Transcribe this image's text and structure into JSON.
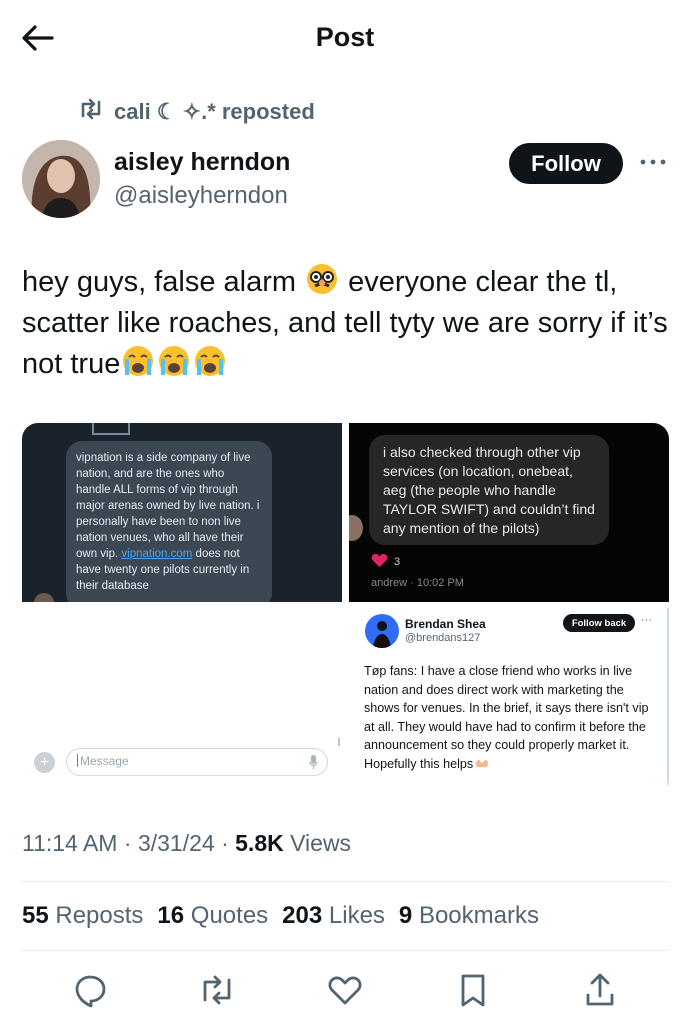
{
  "header": {
    "title": "Post"
  },
  "repost": {
    "text": "cali ☾ ✧.* reposted"
  },
  "author": {
    "name": "aisley herndon",
    "handle": "@aisleyherndon",
    "follow_label": "Follow"
  },
  "post": {
    "text": "hey guys, false alarm ",
    "text2": " everyone clear the tl, scatter like roaches, and tell tyty we are sorry if it’s not true"
  },
  "media": {
    "panel1": {
      "message_pre": "vipnation is a side company of live nation, and are the ones who handle ALL forms of vip through major arenas owned by live nation. i personally have been to non live nation venues, who all have their own vip.",
      "link": "vipnation.com",
      "message_post": " does not have twenty one pilots currently in their database"
    },
    "panel2": {
      "message": "i also checked through other vip services (on location, onebeat, aeg (the people who handle TAYLOR SWIFT) and couldn’t find any mention of the pilots)",
      "reaction_count": "3",
      "meta": "andrew · 10:02 PM"
    },
    "panel3": {
      "placeholder": "Message"
    },
    "panel4": {
      "name": "Brendan Shea",
      "handle": "@brendans127",
      "follow_back": "Follow back",
      "text": "Tøp fans: I have a close friend who works in live nation and does direct work with marketing the shows for venues. In the brief, it says there isn't vip at all. They would have had to confirm it before the announcement so they could properly market it. Hopefully this helps"
    }
  },
  "meta": {
    "time": "11:14 AM",
    "date": "3/31/24",
    "views_count": "5.8K",
    "views_label": " Views"
  },
  "counts": {
    "reposts": "55",
    "reposts_label": " Reposts",
    "quotes": "16",
    "quotes_label": " Quotes",
    "likes": "203",
    "likes_label": " Likes",
    "bookmarks": "9",
    "bookmarks_label": " Bookmarks"
  },
  "colors": {
    "secondary": "#536471",
    "primary": "#0f1419",
    "link": "#1d9bf0",
    "heart": "#e0245e"
  }
}
